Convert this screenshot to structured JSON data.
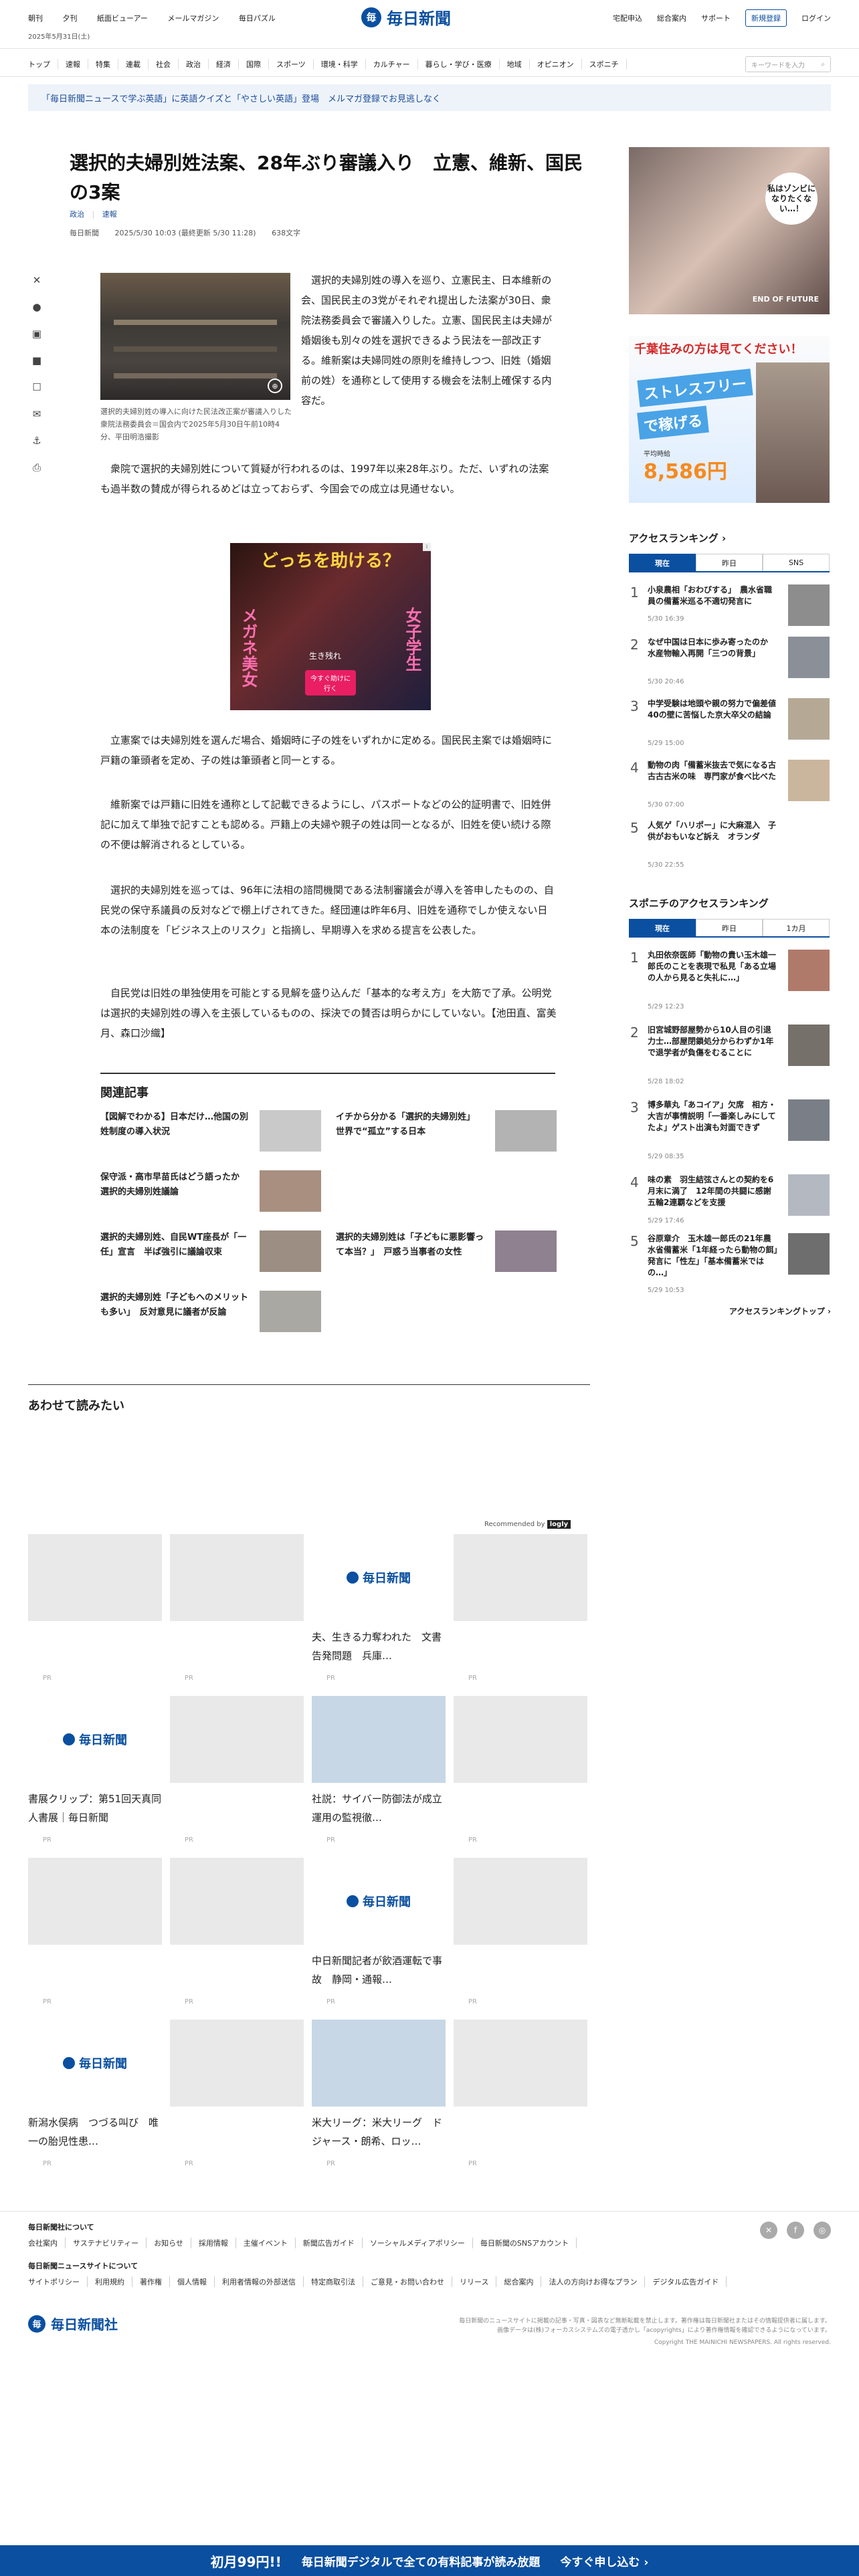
{
  "header": {
    "left_links": [
      "朝刊",
      "夕刊",
      "紙面ビューアー",
      "メールマガジン",
      "毎日パズル"
    ],
    "logo_text": "毎日新聞",
    "right_links": [
      "宅配申込",
      "総合案内",
      "サポート"
    ],
    "register_label": "新規登録",
    "login_label": "ログイン",
    "date": "2025年5月31日(土)",
    "nav": [
      "トップ",
      "速報",
      "特集",
      "連載",
      "社会",
      "政治",
      "経済",
      "国際",
      "スポーツ",
      "環境・科学",
      "カルチャー",
      "暮らし・学び・医療",
      "地域",
      "オピニオン",
      "スポニチ"
    ],
    "search_placeholder": "キーワードを入力"
  },
  "banner": "「毎日新聞ニュースで学ぶ英語」に英語クイズと「やさしい英語」登場　メルマガ登録でお見逃しなく",
  "article": {
    "title": "選択的夫婦別姓法案、28年ぶり審議入り　立憲、維新、国民の3案",
    "tags": [
      "政治",
      "速報"
    ],
    "source": "毎日新聞",
    "datetime": "2025/5/30 10:03 (最終更新 5/30 11:28)",
    "char_count": "638文字",
    "photo_caption": "選択的夫婦別姓の導入に向けた民法改正案が審議入りした衆院法務委員会＝国会内で2025年5月30日午前10時4分、平田明浩撮影",
    "p1": "　選択的夫婦別姓の導入を巡り、立憲民主、日本維新の会、国民民主の3党がそれぞれ提出した法案が30日、衆院法務委員会で審議入りした。立憲、国民民主は夫婦が婚姻後も別々の姓を選択できるよう民法を一部改正する。維新案は夫婦同姓の原則を維持しつつ、旧姓（婚姻前の姓）を通称として使用する機会を法制上確保する内容だ。",
    "p2": "　衆院で選択的夫婦別姓について質疑が行われるのは、1997年以来28年ぶり。ただ、いずれの法案も過半数の賛成が得られるめどは立っておらず、今国会での成立は見通せない。",
    "p3": "　立憲案では夫婦別姓を選んだ場合、婚姻時に子の姓をいずれかに定める。国民民主案では婚姻時に戸籍の筆頭者を定め、子の姓は筆頭者と同一とする。",
    "p4": "　維新案では戸籍に旧姓を通称として記載できるようにし、パスポートなどの公的証明書で、旧姓併記に加えて単独で記すことも認める。戸籍上の夫婦や親子の姓は同一となるが、旧姓を使い続ける際の不便は解消されるとしている。",
    "p5": "　選択的夫婦別姓を巡っては、96年に法相の諮問機関である法制審議会が導入を答申したものの、自民党の保守系議員の反対などで棚上げされてきた。経団連は昨年6月、旧姓を通称でしか使えない日本の法制度を「ビジネス上のリスク」と指摘し、早期導入を求める提言を公表した。",
    "p6": "　自民党は旧姓の単独使用を可能とする見解を盛り込んだ「基本的な考え方」を大筋で了承。公明党は選択的夫婦別姓の導入を主張しているものの、採決での賛否は明らかにしていない。【池田直、富美月、森口沙織】"
  },
  "inline_ad": {
    "headline": "どっちを助ける？",
    "left": "メガネ美女",
    "right": "女子学生",
    "mid": "生き残れ",
    "cta": "今すぐ助けに行く"
  },
  "related": {
    "heading": "関連記事",
    "items": [
      "【図解でわかる】日本だけ…他国の別姓制度の導入状況",
      "イチから分かる「選択的夫婦別姓」　世界で“孤立”する日本",
      "保守派・高市早苗氏はどう語ったか　選択的夫婦別姓議論",
      "選択的夫婦別姓、自民WT座長が「一任」宣言　半ば強引に議論収束",
      "選択的夫婦別姓は「子どもに悪影響って本当？」　戸惑う当事者の女性",
      "選択的夫婦別姓「子どもへのメリットも多い」　反対意見に議者が反論"
    ]
  },
  "side_ad1": {
    "bubble": "私はゾンビになりたくない…！",
    "brand": "END OF FUTURE"
  },
  "side_ad2": {
    "top": "千葉住みの方は見てください！",
    "line1": "ストレスフリー",
    "line2": "で稼げる",
    "label": "平均時給",
    "amount": "8,586円"
  },
  "access_ranking": {
    "title": "アクセスランキング",
    "tabs": [
      "現在",
      "昨日",
      "SNS"
    ],
    "items": [
      {
        "rank": "1",
        "title": "小泉農相「おわびする」　農水省職員の備蓄米巡る不適切発言に",
        "date": "5/30 16:39"
      },
      {
        "rank": "2",
        "title": "なぜ中国は日本に歩み寄ったのか　水産物輸入再開「三つの背景」",
        "date": "5/30 20:46"
      },
      {
        "rank": "3",
        "title": "中学受験は地頭や親の努力で偏差値40の壁に苦悩した京大卒父の結論",
        "date": "5/29 15:00"
      },
      {
        "rank": "4",
        "title": "動物の肉「備蓄米抜去で気になる古古古古米の味　専門家が食べ比べた",
        "date": "5/30 07:00"
      },
      {
        "rank": "5",
        "title": "人気ゲ「ハリポー」に大麻混入　子供がおもいなど訴え　オランダ",
        "date": "5/30 22:55"
      }
    ]
  },
  "sponichi_ranking": {
    "title": "スポニチのアクセスランキング",
    "tabs": [
      "現在",
      "昨日",
      "1カ月"
    ],
    "items": [
      {
        "rank": "1",
        "title": "丸田依奈医師「動物の貴い玉木雄一郎氏のことを表現で私見「ある立場の人から見ると失礼に…」",
        "date": "5/29 12:23"
      },
      {
        "rank": "2",
        "title": "旧宮城野部屋勢から10人目の引退力士…部屋閉鎖処分からわずか1年で退学者が負傷をむることに",
        "date": "5/28 18:02"
      },
      {
        "rank": "3",
        "title": "博多華丸「あコイア」欠席　相方・大吉が事情説明「一番楽しみにしてたよ」ゲスト出演も対面できず",
        "date": "5/29 08:35"
      },
      {
        "rank": "4",
        "title": "味の素　羽生結弦さんとの契約を6月末に満了　12年間の共闘に感謝　五輪2連覇などを支援",
        "date": "5/29 17:46"
      },
      {
        "rank": "5",
        "title": "谷原章介　玉木雄一郎氏の21年農水省備蓄米「1年経ったら動物の餌」発言に「性左」「基本備蓄米ではの…」",
        "date": "5/29 10:53"
      }
    ],
    "more": "アクセスランキングトップ"
  },
  "read_also": {
    "heading": "あわせて読みたい",
    "recommended_by": "Recommended by",
    "recommended_brand": "logly",
    "pr": "PR",
    "cards": [
      {
        "title": "",
        "logo": false
      },
      {
        "title": "",
        "logo": false
      },
      {
        "title": "夫、生きる力奪われた　文書告発問題　兵庫…",
        "logo": true
      },
      {
        "title": "",
        "logo": false
      },
      {
        "title": "書展クリップ：第51回天真同人書展｜毎日新聞",
        "logo": true
      },
      {
        "title": "",
        "logo": false
      },
      {
        "title": "社説：サイバー防御法が成立　運用の監視徹…",
        "logo": false
      },
      {
        "title": "",
        "logo": false
      },
      {
        "title": "",
        "logo": false
      },
      {
        "title": "",
        "logo": false
      },
      {
        "title": "中日新聞記者が飲酒運転で事故　静岡・通報…",
        "logo": true
      },
      {
        "title": "",
        "logo": false
      },
      {
        "title": "新潟水俣病　つづる叫び　唯一の胎児性患…",
        "logo": true
      },
      {
        "title": "",
        "logo": false
      },
      {
        "title": "米大リーグ：米大リーグ　ドジャース・朗希、ロッ…",
        "logo": false
      },
      {
        "title": "",
        "logo": false
      }
    ]
  },
  "footer": {
    "about_title": "毎日新聞社について",
    "about_links": [
      "会社案内",
      "サステナビリティー",
      "お知らせ",
      "採用情報",
      "主催イベント",
      "新聞広告ガイド",
      "ソーシャルメディアポリシー",
      "毎日新聞のSNSアカウント"
    ],
    "site_title": "毎日新聞ニュースサイトについて",
    "site_links": [
      "サイトポリシー",
      "利用規約",
      "著作権",
      "個人情報",
      "利用者情報の外部送信",
      "特定商取引法",
      "ご意見・お問い合わせ",
      "リリース",
      "総合案内",
      "法人の方向けお得なプラン",
      "デジタル広告ガイド"
    ],
    "company": "毎日新聞社",
    "notice": "毎日新聞のニュースサイトに掲載の記事・写真・図表など無断転載を禁止します。著作権は毎日新聞社またはその情報提供者に属します。",
    "notice2": "画像データは(株)フォーカスシステムズの電子透かし「acopyrights」により著作権情報を確認できるようになっています。",
    "copyright": "Copyright THE MAINICHI NEWSPAPERS. All rights reserved."
  },
  "bottom_bar": {
    "price": "初月99円!!",
    "text": "毎日新聞デジタルで全ての有料記事が読み放題",
    "cta": "今すぐ申し込む ›"
  }
}
